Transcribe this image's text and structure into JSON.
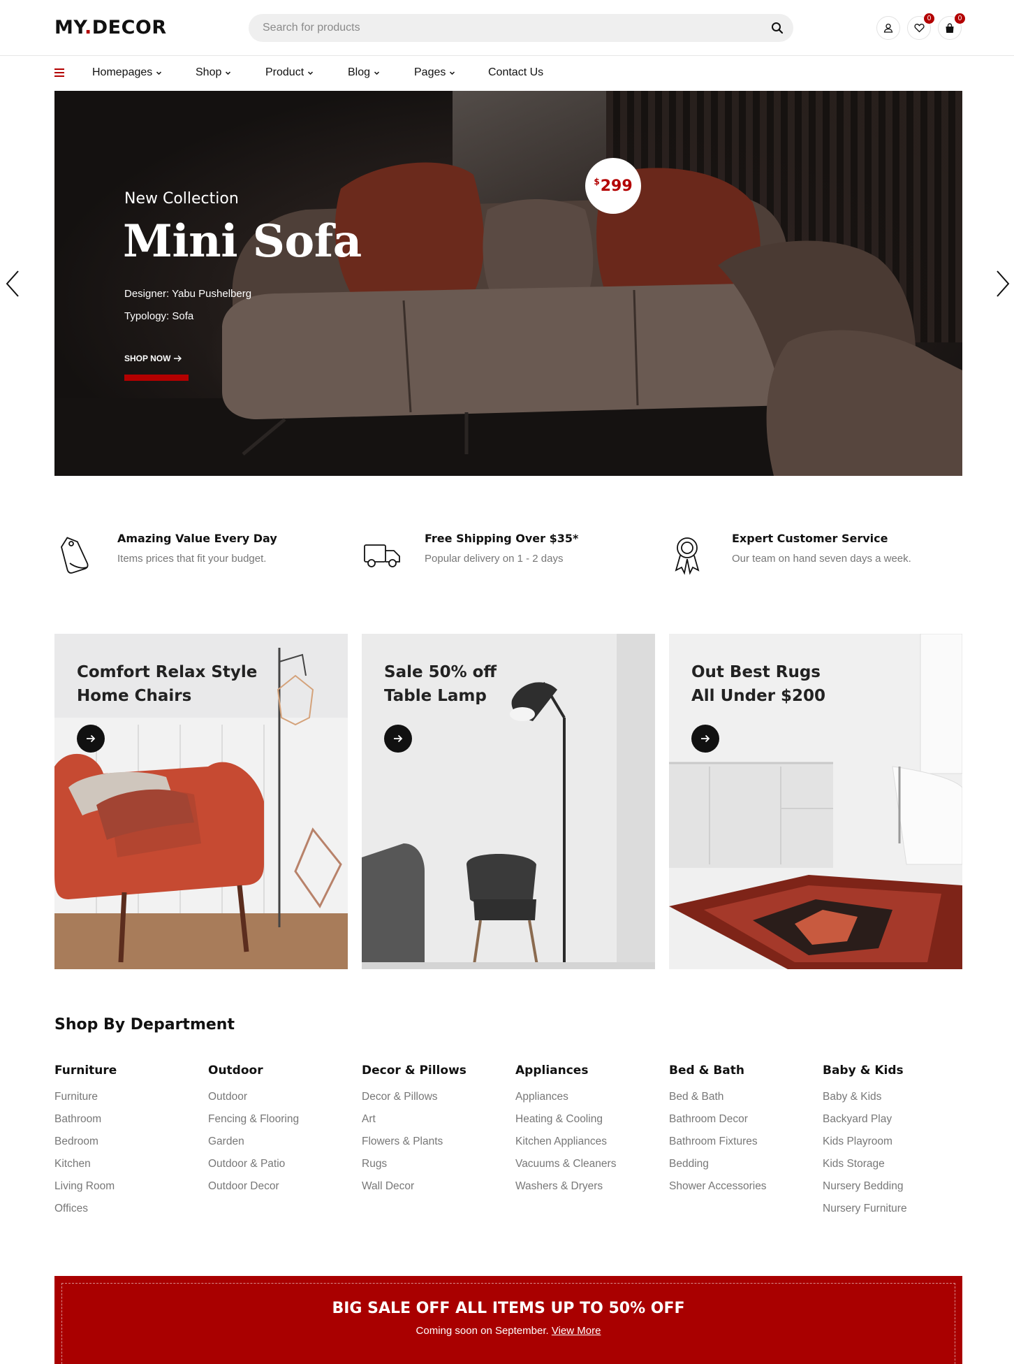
{
  "brand": {
    "name_left": "MY",
    "name_dot": ".",
    "name_right": "DECOR",
    "accent_color": "#b30000"
  },
  "search": {
    "placeholder": "Search for products",
    "icon": "search-icon"
  },
  "header_icons": {
    "account": {
      "icon": "user-icon"
    },
    "wishlist": {
      "icon": "heart-icon",
      "count": "0"
    },
    "cart": {
      "icon": "shopping-bag-icon",
      "count": "0"
    }
  },
  "nav": {
    "menu_icon": "hamburger-menu-icon",
    "items": [
      {
        "label": "Homepages",
        "has_dropdown": true
      },
      {
        "label": "Shop",
        "has_dropdown": true
      },
      {
        "label": "Product",
        "has_dropdown": true
      },
      {
        "label": "Blog",
        "has_dropdown": true
      },
      {
        "label": "Pages",
        "has_dropdown": true
      },
      {
        "label": "Contact Us",
        "has_dropdown": false
      }
    ]
  },
  "hero": {
    "eyebrow": "New Collection",
    "title": "Mini Sofa",
    "designer": "Designer: Yabu Pushelberg",
    "typology": "Typology: Sofa",
    "cta": "SHOP NOW",
    "price_currency": "$",
    "price_value": "299",
    "prev_icon": "chevron-left-icon",
    "next_icon": "chevron-right-icon"
  },
  "features": [
    {
      "title": "Amazing Value Every Day",
      "subtitle": "Items prices that fit your budget.",
      "icon": "price-tag-icon"
    },
    {
      "title": "Free Shipping Over $35*",
      "subtitle": "Popular delivery on 1 - 2 days",
      "icon": "delivery-truck-icon"
    },
    {
      "title": "Expert Customer Service",
      "subtitle": "Our team on hand seven days a week.",
      "icon": "award-badge-icon"
    }
  ],
  "promos": [
    {
      "line1": "Comfort Relax Style",
      "line2": "Home Chairs"
    },
    {
      "line1": "Sale 50% off",
      "line2": "Table Lamp"
    },
    {
      "line1": "Out Best Rugs",
      "line2": "All Under $200"
    }
  ],
  "departments": {
    "title": "Shop By Department",
    "columns": [
      {
        "heading": "Furniture",
        "links": [
          "Furniture",
          "Bathroom",
          "Bedroom",
          "Kitchen",
          "Living Room",
          "Offices"
        ]
      },
      {
        "heading": "Outdoor",
        "links": [
          "Outdoor",
          "Fencing & Flooring",
          "Garden",
          "Outdoor & Patio",
          "Outdoor Decor"
        ]
      },
      {
        "heading": "Decor & Pillows",
        "links": [
          "Decor & Pillows",
          "Art",
          "Flowers & Plants",
          "Rugs",
          "Wall Decor"
        ]
      },
      {
        "heading": "Appliances",
        "links": [
          "Appliances",
          "Heating & Cooling",
          "Kitchen Appliances",
          "Vacuums & Cleaners",
          "Washers & Dryers"
        ]
      },
      {
        "heading": "Bed & Bath",
        "links": [
          "Bed & Bath",
          "Bathroom Decor",
          "Bathroom Fixtures",
          "Bedding",
          "Shower Accessories"
        ]
      },
      {
        "heading": "Baby & Kids",
        "links": [
          "Baby & Kids",
          "Backyard Play",
          "Kids Playroom",
          "Kids Storage",
          "Nursery Bedding",
          "Nursery Furniture"
        ]
      }
    ]
  },
  "sale_banner": {
    "title": "BIG SALE OFF ALL ITEMS UP TO 50% OFF",
    "text": "Coming soon on September.",
    "link": "View More",
    "color": "#a90000"
  }
}
